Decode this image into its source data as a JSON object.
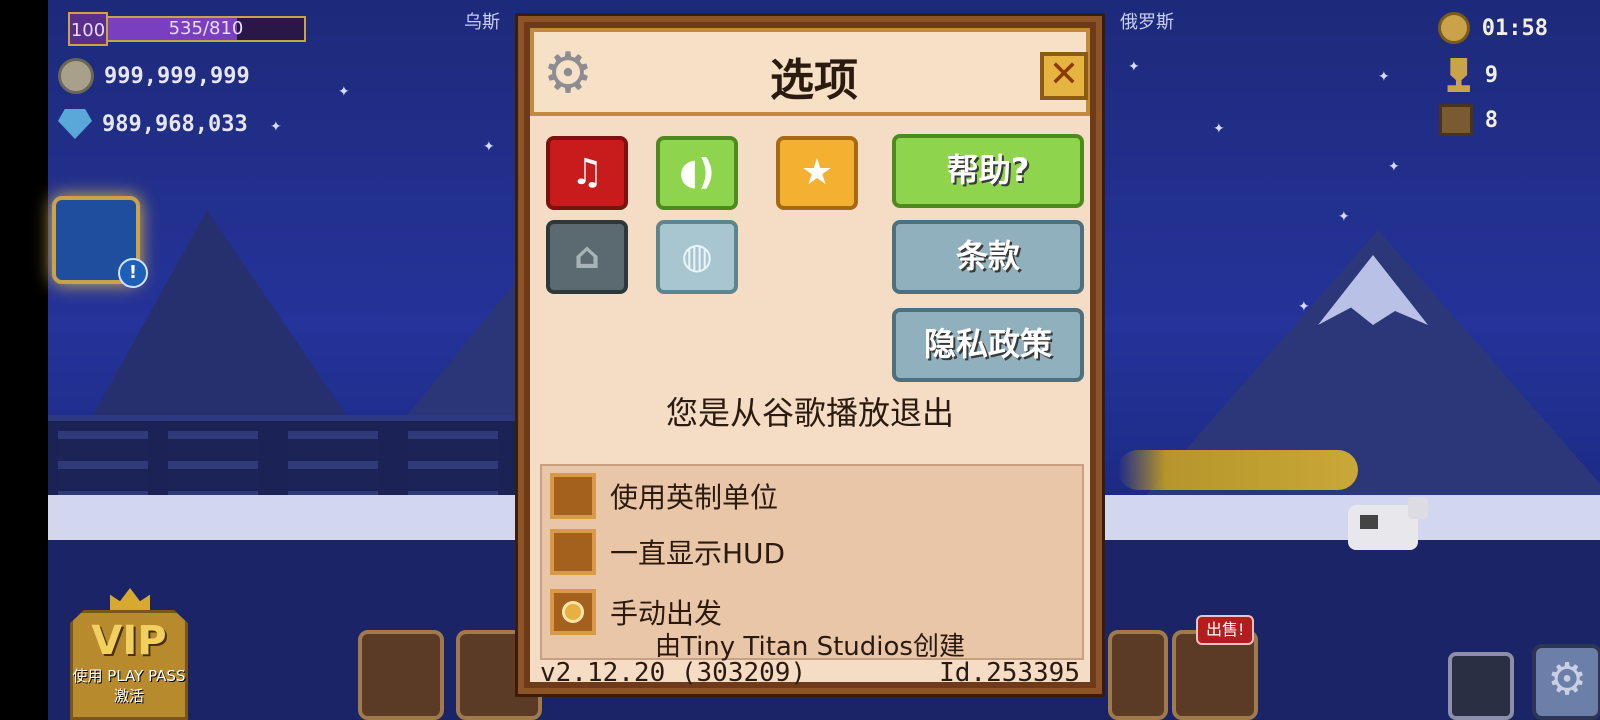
{
  "hud": {
    "level": "100",
    "xp": "535/810",
    "xp_progress": 0.66,
    "gold": "999,999,999",
    "gems": "989,968,033",
    "time": "01:58",
    "trophies": "9",
    "crates": "8",
    "top_left_text": "乌斯",
    "top_right_text": "俄罗斯",
    "sell_badge": "出售!",
    "vip_title": "VIP",
    "vip_subtitle": "使用 PLAY PASS 激活"
  },
  "dialog": {
    "title": "选项",
    "close_symbol": "✕",
    "buttons": {
      "help": "帮助?",
      "terms": "条款",
      "privacy": "隐私政策"
    },
    "sign_out_text": "您是从谷歌播放退出",
    "options": [
      {
        "label": "使用英制单位",
        "checked": false
      },
      {
        "label": "一直显示HUD",
        "checked": false
      },
      {
        "label": "手动出发",
        "checked": true
      }
    ],
    "credit": "由Tiny Titan Studios创建",
    "version": "v2.12.20 (303209)",
    "device_id": "Id.253395"
  },
  "icons": {
    "music": "music-muted-icon",
    "sound": "speaker-icon",
    "rate": "star-icon",
    "game_services": "gamepad-icon",
    "language": "globe-chat-icon",
    "settings": "gear-icon"
  },
  "colors": {
    "red_button": "#c81c1c",
    "green_button": "#8ed44c",
    "orange_button": "#f4b030",
    "blue_button": "#8fb0bc",
    "dialog_bg": "#f5dcc4"
  }
}
